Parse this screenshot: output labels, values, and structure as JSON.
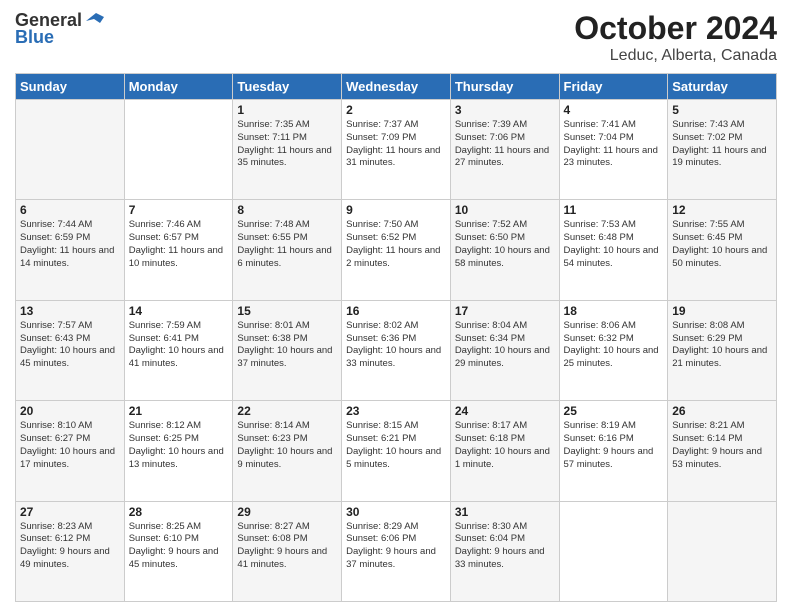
{
  "header": {
    "logo_general": "General",
    "logo_blue": "Blue",
    "title": "October 2024",
    "subtitle": "Leduc, Alberta, Canada"
  },
  "days_of_week": [
    "Sunday",
    "Monday",
    "Tuesday",
    "Wednesday",
    "Thursday",
    "Friday",
    "Saturday"
  ],
  "weeks": [
    [
      {
        "day": "",
        "info": ""
      },
      {
        "day": "",
        "info": ""
      },
      {
        "day": "1",
        "info": "Sunrise: 7:35 AM\nSunset: 7:11 PM\nDaylight: 11 hours and 35 minutes."
      },
      {
        "day": "2",
        "info": "Sunrise: 7:37 AM\nSunset: 7:09 PM\nDaylight: 11 hours and 31 minutes."
      },
      {
        "day": "3",
        "info": "Sunrise: 7:39 AM\nSunset: 7:06 PM\nDaylight: 11 hours and 27 minutes."
      },
      {
        "day": "4",
        "info": "Sunrise: 7:41 AM\nSunset: 7:04 PM\nDaylight: 11 hours and 23 minutes."
      },
      {
        "day": "5",
        "info": "Sunrise: 7:43 AM\nSunset: 7:02 PM\nDaylight: 11 hours and 19 minutes."
      }
    ],
    [
      {
        "day": "6",
        "info": "Sunrise: 7:44 AM\nSunset: 6:59 PM\nDaylight: 11 hours and 14 minutes."
      },
      {
        "day": "7",
        "info": "Sunrise: 7:46 AM\nSunset: 6:57 PM\nDaylight: 11 hours and 10 minutes."
      },
      {
        "day": "8",
        "info": "Sunrise: 7:48 AM\nSunset: 6:55 PM\nDaylight: 11 hours and 6 minutes."
      },
      {
        "day": "9",
        "info": "Sunrise: 7:50 AM\nSunset: 6:52 PM\nDaylight: 11 hours and 2 minutes."
      },
      {
        "day": "10",
        "info": "Sunrise: 7:52 AM\nSunset: 6:50 PM\nDaylight: 10 hours and 58 minutes."
      },
      {
        "day": "11",
        "info": "Sunrise: 7:53 AM\nSunset: 6:48 PM\nDaylight: 10 hours and 54 minutes."
      },
      {
        "day": "12",
        "info": "Sunrise: 7:55 AM\nSunset: 6:45 PM\nDaylight: 10 hours and 50 minutes."
      }
    ],
    [
      {
        "day": "13",
        "info": "Sunrise: 7:57 AM\nSunset: 6:43 PM\nDaylight: 10 hours and 45 minutes."
      },
      {
        "day": "14",
        "info": "Sunrise: 7:59 AM\nSunset: 6:41 PM\nDaylight: 10 hours and 41 minutes."
      },
      {
        "day": "15",
        "info": "Sunrise: 8:01 AM\nSunset: 6:38 PM\nDaylight: 10 hours and 37 minutes."
      },
      {
        "day": "16",
        "info": "Sunrise: 8:02 AM\nSunset: 6:36 PM\nDaylight: 10 hours and 33 minutes."
      },
      {
        "day": "17",
        "info": "Sunrise: 8:04 AM\nSunset: 6:34 PM\nDaylight: 10 hours and 29 minutes."
      },
      {
        "day": "18",
        "info": "Sunrise: 8:06 AM\nSunset: 6:32 PM\nDaylight: 10 hours and 25 minutes."
      },
      {
        "day": "19",
        "info": "Sunrise: 8:08 AM\nSunset: 6:29 PM\nDaylight: 10 hours and 21 minutes."
      }
    ],
    [
      {
        "day": "20",
        "info": "Sunrise: 8:10 AM\nSunset: 6:27 PM\nDaylight: 10 hours and 17 minutes."
      },
      {
        "day": "21",
        "info": "Sunrise: 8:12 AM\nSunset: 6:25 PM\nDaylight: 10 hours and 13 minutes."
      },
      {
        "day": "22",
        "info": "Sunrise: 8:14 AM\nSunset: 6:23 PM\nDaylight: 10 hours and 9 minutes."
      },
      {
        "day": "23",
        "info": "Sunrise: 8:15 AM\nSunset: 6:21 PM\nDaylight: 10 hours and 5 minutes."
      },
      {
        "day": "24",
        "info": "Sunrise: 8:17 AM\nSunset: 6:18 PM\nDaylight: 10 hours and 1 minute."
      },
      {
        "day": "25",
        "info": "Sunrise: 8:19 AM\nSunset: 6:16 PM\nDaylight: 9 hours and 57 minutes."
      },
      {
        "day": "26",
        "info": "Sunrise: 8:21 AM\nSunset: 6:14 PM\nDaylight: 9 hours and 53 minutes."
      }
    ],
    [
      {
        "day": "27",
        "info": "Sunrise: 8:23 AM\nSunset: 6:12 PM\nDaylight: 9 hours and 49 minutes."
      },
      {
        "day": "28",
        "info": "Sunrise: 8:25 AM\nSunset: 6:10 PM\nDaylight: 9 hours and 45 minutes."
      },
      {
        "day": "29",
        "info": "Sunrise: 8:27 AM\nSunset: 6:08 PM\nDaylight: 9 hours and 41 minutes."
      },
      {
        "day": "30",
        "info": "Sunrise: 8:29 AM\nSunset: 6:06 PM\nDaylight: 9 hours and 37 minutes."
      },
      {
        "day": "31",
        "info": "Sunrise: 8:30 AM\nSunset: 6:04 PM\nDaylight: 9 hours and 33 minutes."
      },
      {
        "day": "",
        "info": ""
      },
      {
        "day": "",
        "info": ""
      }
    ]
  ]
}
